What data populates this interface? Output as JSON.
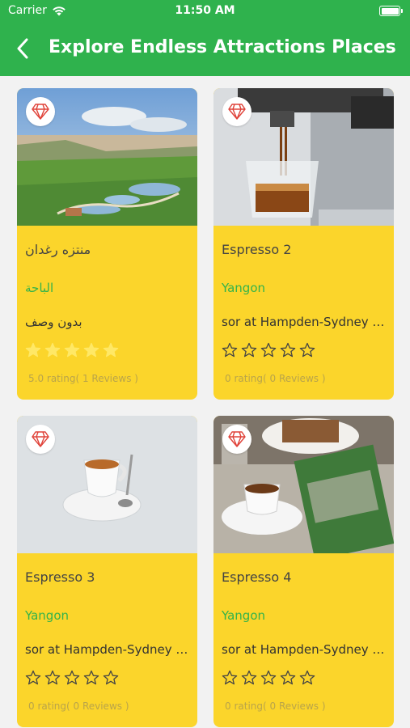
{
  "status_bar": {
    "carrier": "Carrier",
    "time": "11:50 AM"
  },
  "header": {
    "title": "Explore Endless Attractions Places",
    "back_icon": "chevron-left-icon"
  },
  "colors": {
    "primary": "#2fb24d",
    "card": "#fbd52b",
    "city": "#34b34a",
    "badge_icon": "#e0433a"
  },
  "places": [
    {
      "title": "منتزه رغدان",
      "city": "الباحة",
      "description": "بدون وصف",
      "stars": 5,
      "rating_text": "5.0 rating( 1 Reviews )"
    },
    {
      "title": "Espresso 2",
      "city": "Yangon",
      "description": "sor at Hampden-Sydney College in Virginia",
      "stars": 0,
      "rating_text": "0 rating( 0 Reviews )"
    },
    {
      "title": "Espresso 3",
      "city": "Yangon",
      "description": "sor at Hampden-Sydney College in Virginia",
      "stars": 0,
      "rating_text": "0 rating( 0 Reviews )"
    },
    {
      "title": "Espresso 4",
      "city": "Yangon",
      "description": "sor at Hampden-Sydney College in Virginia",
      "stars": 0,
      "rating_text": "0 rating( 0 Reviews )"
    }
  ]
}
